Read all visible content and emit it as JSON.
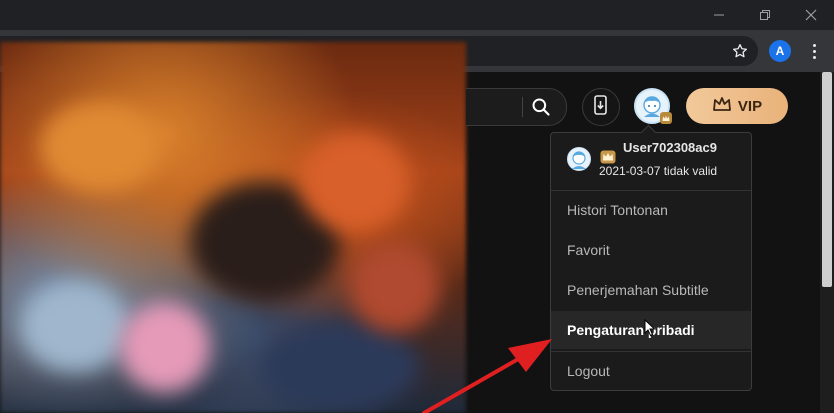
{
  "window": {
    "minimize_icon": "minimize-icon",
    "restore_icon": "restore-icon",
    "close_icon": "close-icon"
  },
  "browser": {
    "profile_initial": "A",
    "bookmark_icon": "star-icon",
    "menu_icon": "kebab-menu-icon"
  },
  "header": {
    "search_icon": "search-icon",
    "app_icon": "phone-download-icon",
    "vip_label": "VIP",
    "vip_icon": "crown-icon"
  },
  "dropdown": {
    "username": "User702308ac9",
    "expiry": "2021-03-07 tidak valid",
    "items": [
      {
        "label": "Histori Tontonan"
      },
      {
        "label": "Favorit"
      },
      {
        "label": "Penerjemahan Subtitle"
      },
      {
        "label": "Pengaturan pribadi"
      },
      {
        "label": "Logout"
      }
    ]
  },
  "colors": {
    "accent_vip": "#e9b27a",
    "annotation_arrow": "#e02020",
    "menu_bg": "#1b1b1b"
  }
}
